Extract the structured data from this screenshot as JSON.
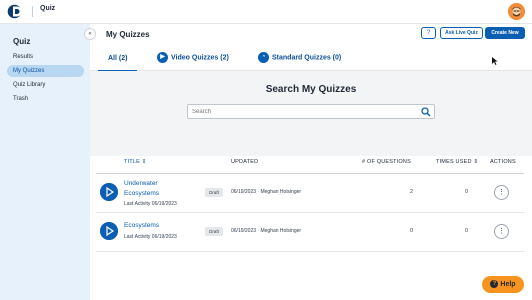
{
  "header": {
    "app_name": "Quiz"
  },
  "sidebar": {
    "title": "Quiz",
    "collapse_icon": "chevrons-left-icon",
    "items": [
      {
        "label": "Results"
      },
      {
        "label": "My Quizzes",
        "active": true
      },
      {
        "label": "Quiz Library"
      },
      {
        "label": "Trash"
      }
    ]
  },
  "main": {
    "page_title": "My Quizzes",
    "actions": {
      "help_glyph": "?",
      "ask_live_label": "Ask Live Quiz",
      "create_label": "Create New"
    },
    "tabs": [
      {
        "label": "All (2)",
        "active": true
      },
      {
        "label": "Video Quizzes (2)",
        "icon": "play-icon"
      },
      {
        "label": "Standard Quizzes (0)",
        "icon": "quiz-icon"
      }
    ],
    "search": {
      "title": "Search My Quizzes",
      "placeholder": "Search",
      "value": ""
    },
    "table": {
      "headers": {
        "title": "TITLE",
        "updated": "UPDATED",
        "questions": "# OF QUESTIONS",
        "times_used": "TIMES USED",
        "actions": "ACTIONS"
      },
      "rows": [
        {
          "title_line1": "Underwater",
          "title_line2": "Ecosystems",
          "last_activity": "Last Activity 06/19/2023",
          "status": "Draft",
          "updated": "06/19/2023 · Meghan Holsinger",
          "questions": "2",
          "times_used": "0",
          "actions_glyph": "⋮"
        },
        {
          "title_line1": "Ecosystems",
          "title_line2": "",
          "last_activity": "Last Activity 06/19/2023",
          "status": "Draft",
          "updated": "06/19/2023 · Meghan Holsinger",
          "questions": "0",
          "times_used": "0",
          "actions_glyph": "⋮"
        }
      ]
    }
  },
  "help_fab": {
    "label": "Help",
    "glyph": "?"
  },
  "colors": {
    "brand_blue": "#0b5fb3",
    "sidebar_bg": "#e6f1fb",
    "active_bg": "#b7d7f2",
    "help_orange": "#f7931e"
  }
}
